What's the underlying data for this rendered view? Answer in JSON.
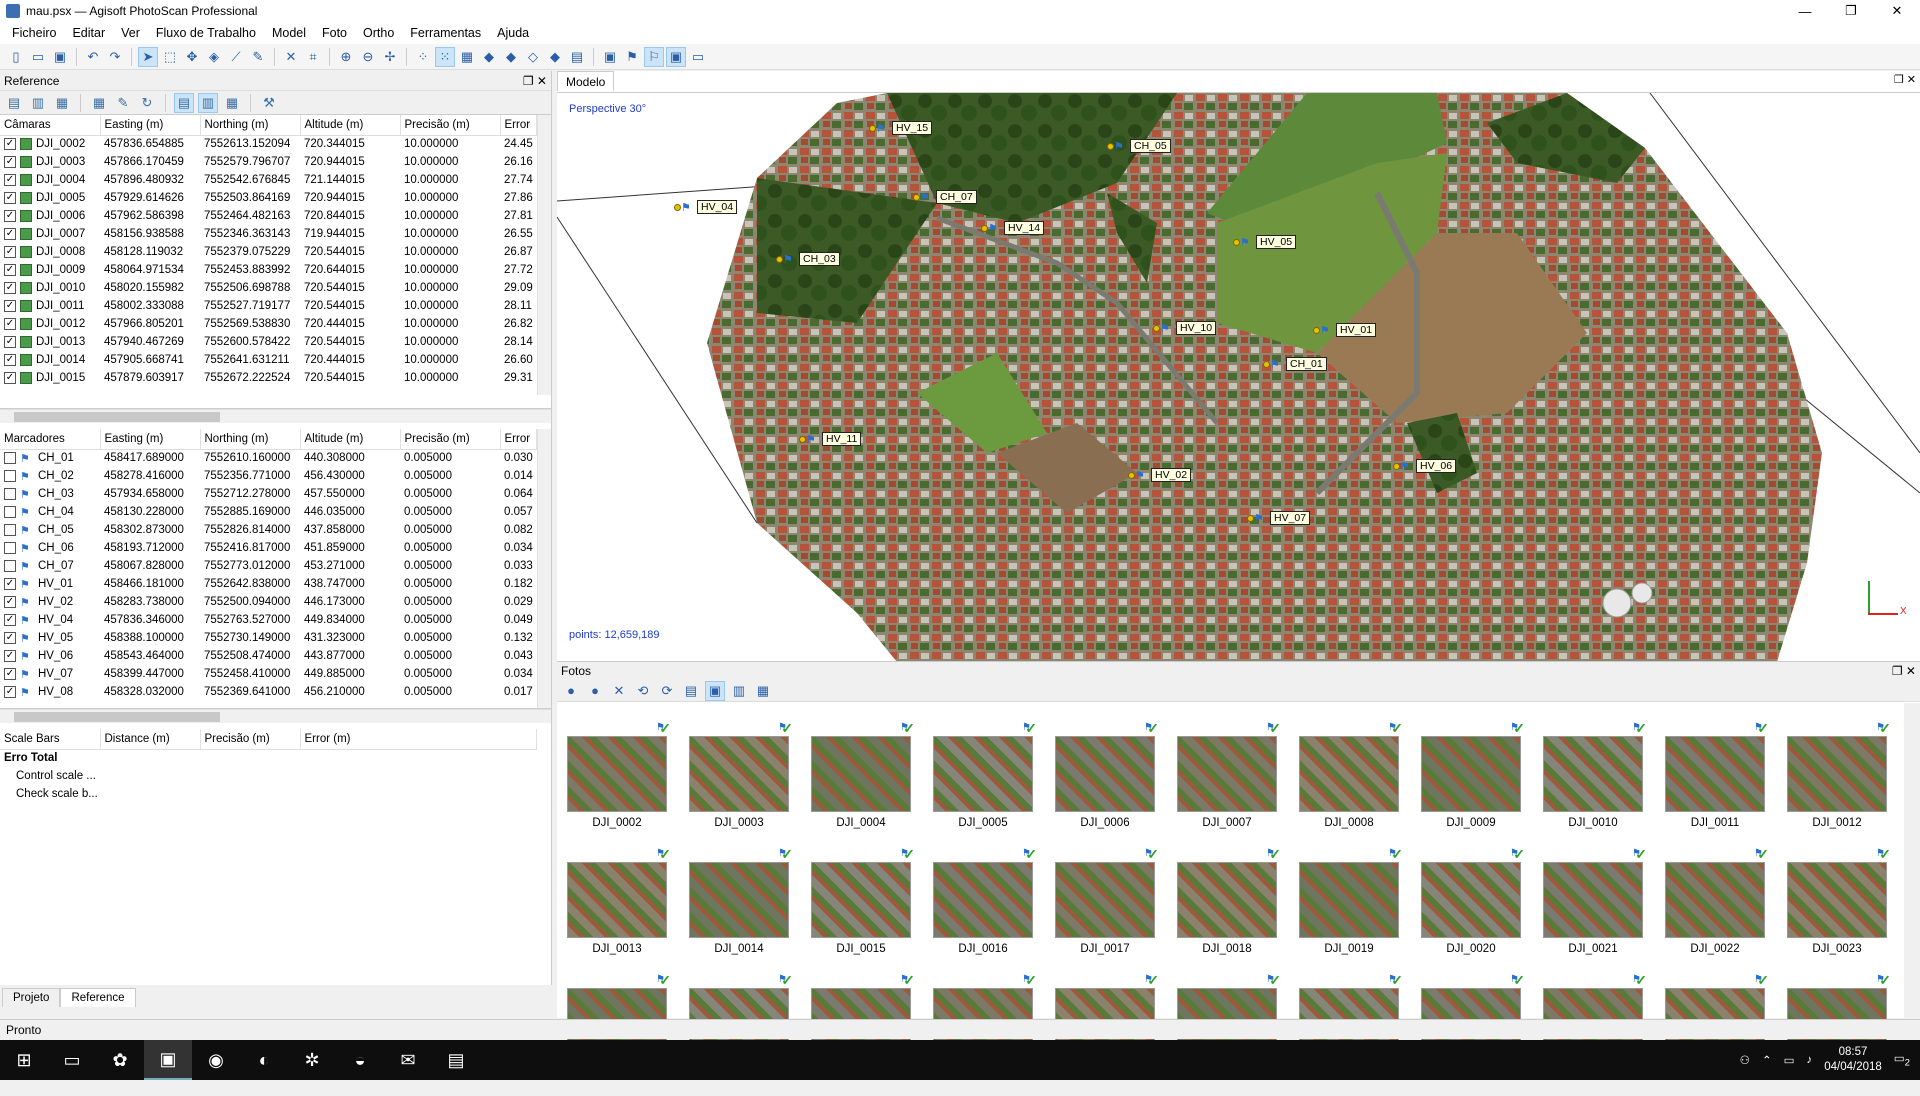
{
  "window": {
    "title": "mau.psx — Agisoft PhotoScan Professional",
    "min": "—",
    "max": "❐",
    "close": "✕"
  },
  "menu": [
    "Ficheiro",
    "Editar",
    "Ver",
    "Fluxo de Trabalho",
    "Model",
    "Foto",
    "Ortho",
    "Ferramentas",
    "Ajuda"
  ],
  "reference": {
    "title": "Reference",
    "cameras_headers": [
      "Câmaras",
      "Easting (m)",
      "Northing (m)",
      "Altitude (m)",
      "Precisão (m)",
      "Error"
    ],
    "cameras": [
      [
        "DJI_0002",
        "457836.654885",
        "7552613.152094",
        "720.344015",
        "10.000000",
        "24.45"
      ],
      [
        "DJI_0003",
        "457866.170459",
        "7552579.796707",
        "720.944015",
        "10.000000",
        "26.16"
      ],
      [
        "DJI_0004",
        "457896.480932",
        "7552542.676845",
        "721.144015",
        "10.000000",
        "27.74"
      ],
      [
        "DJI_0005",
        "457929.614626",
        "7552503.864169",
        "720.944015",
        "10.000000",
        "27.86"
      ],
      [
        "DJI_0006",
        "457962.586398",
        "7552464.482163",
        "720.844015",
        "10.000000",
        "27.81"
      ],
      [
        "DJI_0007",
        "458156.938588",
        "7552346.363143",
        "719.944015",
        "10.000000",
        "26.55"
      ],
      [
        "DJI_0008",
        "458128.119032",
        "7552379.075229",
        "720.544015",
        "10.000000",
        "26.87"
      ],
      [
        "DJI_0009",
        "458064.971534",
        "7552453.883992",
        "720.644015",
        "10.000000",
        "27.72"
      ],
      [
        "DJI_0010",
        "458020.155982",
        "7552506.698788",
        "720.544015",
        "10.000000",
        "29.09"
      ],
      [
        "DJI_0011",
        "458002.333088",
        "7552527.719177",
        "720.544015",
        "10.000000",
        "28.11"
      ],
      [
        "DJI_0012",
        "457966.805201",
        "7552569.538830",
        "720.444015",
        "10.000000",
        "26.82"
      ],
      [
        "DJI_0013",
        "457940.467269",
        "7552600.578422",
        "720.544015",
        "10.000000",
        "28.14"
      ],
      [
        "DJI_0014",
        "457905.668741",
        "7552641.631211",
        "720.444015",
        "10.000000",
        "26.60"
      ],
      [
        "DJI_0015",
        "457879.603917",
        "7552672.222524",
        "720.544015",
        "10.000000",
        "29.31"
      ]
    ],
    "markers_headers": [
      "Marcadores",
      "Easting (m)",
      "Northing (m)",
      "Altitude (m)",
      "Precisão (m)",
      "Error"
    ],
    "markers": [
      {
        "v": [
          "CH_01",
          "458417.689000",
          "7552610.160000",
          "440.308000",
          "0.005000",
          "0.030"
        ],
        "checked": false
      },
      {
        "v": [
          "CH_02",
          "458278.416000",
          "7552356.771000",
          "456.430000",
          "0.005000",
          "0.014"
        ],
        "checked": false
      },
      {
        "v": [
          "CH_03",
          "457934.658000",
          "7552712.278000",
          "457.550000",
          "0.005000",
          "0.064"
        ],
        "checked": false
      },
      {
        "v": [
          "CH_04",
          "458130.228000",
          "7552885.169000",
          "446.035000",
          "0.005000",
          "0.057"
        ],
        "checked": false
      },
      {
        "v": [
          "CH_05",
          "458302.873000",
          "7552826.814000",
          "437.858000",
          "0.005000",
          "0.082"
        ],
        "checked": false
      },
      {
        "v": [
          "CH_06",
          "458193.712000",
          "7552416.817000",
          "451.859000",
          "0.005000",
          "0.034"
        ],
        "checked": false
      },
      {
        "v": [
          "CH_07",
          "458067.828000",
          "7552773.012000",
          "453.271000",
          "0.005000",
          "0.033"
        ],
        "checked": false
      },
      {
        "v": [
          "HV_01",
          "458466.181000",
          "7552642.838000",
          "438.747000",
          "0.005000",
          "0.182"
        ],
        "checked": true
      },
      {
        "v": [
          "HV_02",
          "458283.738000",
          "7552500.094000",
          "446.173000",
          "0.005000",
          "0.029"
        ],
        "checked": true
      },
      {
        "v": [
          "HV_04",
          "457836.346000",
          "7552763.527000",
          "449.834000",
          "0.005000",
          "0.049"
        ],
        "checked": true
      },
      {
        "v": [
          "HV_05",
          "458388.100000",
          "7552730.149000",
          "431.323000",
          "0.005000",
          "0.132"
        ],
        "checked": true
      },
      {
        "v": [
          "HV_06",
          "458543.464000",
          "7552508.474000",
          "443.877000",
          "0.005000",
          "0.043"
        ],
        "checked": true
      },
      {
        "v": [
          "HV_07",
          "458399.447000",
          "7552458.410000",
          "449.885000",
          "0.005000",
          "0.034"
        ],
        "checked": true
      },
      {
        "v": [
          "HV_08",
          "458328.032000",
          "7552369.641000",
          "456.210000",
          "0.005000",
          "0.017"
        ],
        "checked": true
      }
    ],
    "scale_headers": [
      "Scale Bars",
      "Distance (m)",
      "Precisão (m)",
      "Error (m)"
    ],
    "scale_rows": [
      "Erro Total",
      "Control scale ...",
      "Check scale b..."
    ]
  },
  "left_tabs": [
    "Projeto",
    "Reference"
  ],
  "model": {
    "tab": "Modelo",
    "perspective": "Perspective 30°",
    "points": "points: 12,659,189",
    "axis_x": "X",
    "markers": [
      "HV_15",
      "CH_05",
      "HV_04",
      "CH_07",
      "HV_14",
      "HV_05",
      "CH_03",
      "HV_10",
      "HV_01",
      "CH_01",
      "HV_11",
      "HV_02",
      "HV_06",
      "HV_07"
    ]
  },
  "photos": {
    "title": "Fotos",
    "names": [
      "DJI_0002",
      "DJI_0003",
      "DJI_0004",
      "DJI_0005",
      "DJI_0006",
      "DJI_0007",
      "DJI_0008",
      "DJI_0009",
      "DJI_0010",
      "DJI_0011",
      "DJI_0012",
      "DJI_0013",
      "DJI_0014",
      "DJI_0015",
      "DJI_0016",
      "DJI_0017",
      "DJI_0018",
      "DJI_0019",
      "DJI_0020",
      "DJI_0021",
      "DJI_0022",
      "DJI_0023"
    ]
  },
  "status": "Pronto",
  "taskbar": {
    "time": "08:57",
    "date": "04/04/2018",
    "notif": "2"
  }
}
